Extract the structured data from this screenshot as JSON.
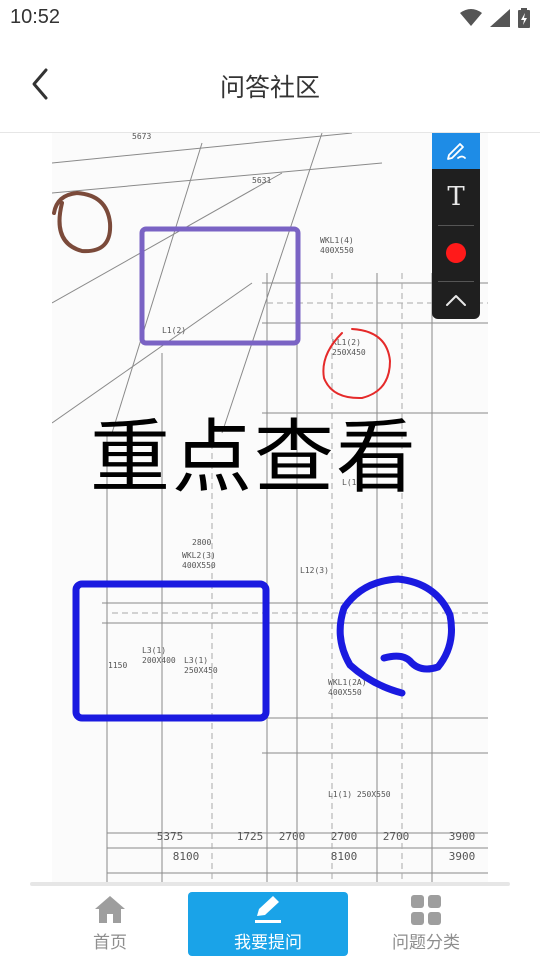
{
  "status_bar": {
    "time": "10:52"
  },
  "header": {
    "title": "问答社区"
  },
  "annotation": {
    "text": "重点查看"
  },
  "toolbar": {
    "text_tool_label": "T",
    "color": "#ff1a1a",
    "active_color": "#1e8ce6"
  },
  "drawing": {
    "dims_row1": [
      "5375",
      "1725",
      "2700",
      "2700",
      "2700",
      "3900"
    ],
    "dims_row2": [
      "8100",
      "8100",
      "3900"
    ],
    "top_labels": [
      "5673",
      "5631"
    ],
    "notes": [
      "WKL1(4)",
      "400X550",
      "250X450",
      "KL1(2)",
      "L1(2)",
      "WKL2(3)",
      "400X550",
      "L3(1)",
      "200X400",
      "L3(1)",
      "250X450",
      "WKL1(2A)",
      "400X550",
      "L1(1) 250X550",
      "2800",
      "L12(3)",
      "L(1)",
      "1150"
    ]
  },
  "tabs": [
    {
      "label": "首页",
      "icon": "home-icon"
    },
    {
      "label": "我要提问",
      "icon": "edit-icon"
    },
    {
      "label": "问题分类",
      "icon": "grid-icon"
    }
  ]
}
